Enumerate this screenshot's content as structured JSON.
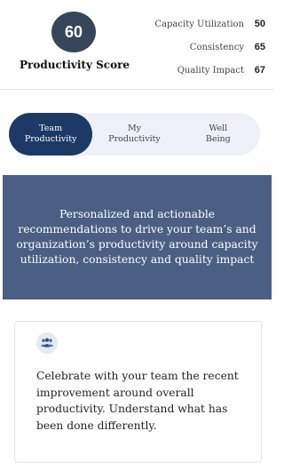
{
  "score": {
    "value": "60",
    "title": "Productivity Score",
    "metrics": [
      {
        "label": "Capacity Utilization",
        "value": "50"
      },
      {
        "label": "Consistency",
        "value": "65"
      },
      {
        "label": "Quality Impact",
        "value": "67"
      }
    ]
  },
  "tabs": [
    {
      "line1": "Team",
      "line2": "Productivity",
      "active": true
    },
    {
      "line1": "My",
      "line2": "Productivity",
      "active": false
    },
    {
      "line1": "Well",
      "line2": "Being",
      "active": false
    }
  ],
  "banner": {
    "text": "Personalized and actionable recommendations to drive your team’s and organization’s productivity around capacity utilization, consistency and quality impact"
  },
  "card": {
    "icon": "team-icon",
    "text": "Celebrate with your team the recent improvement around overall productivity. Understand what has been done differently."
  },
  "colors": {
    "score_circle": "#36475a",
    "active_tab": "#1d3a66",
    "tab_track": "#eef0f7",
    "banner_bg": "#4a5f83"
  }
}
